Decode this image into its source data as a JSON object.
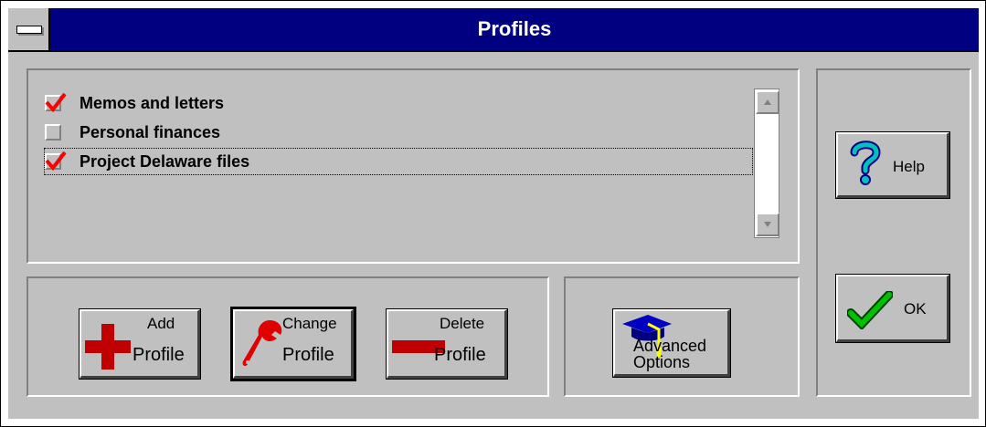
{
  "window": {
    "title": "Profiles"
  },
  "profiles": {
    "items": [
      {
        "label": "Memos and letters",
        "checked": true
      },
      {
        "label": "Personal finances",
        "checked": false
      },
      {
        "label": "Project Delaware files",
        "checked": true
      }
    ],
    "scroll_up_icon": "scroll-up-arrow-icon",
    "scroll_down_icon": "scroll-down-arrow-icon"
  },
  "actions": {
    "add": {
      "line1": "Add",
      "line2": "Profile",
      "icon": "plus-icon"
    },
    "change": {
      "line1": "Change",
      "line2": "Profile",
      "icon": "wrench-icon"
    },
    "delete": {
      "line1": "Delete",
      "line2": "Profile",
      "icon": "minus-icon"
    },
    "advanced": {
      "line1": "Advanced",
      "line2": "Options",
      "icon": "graduation-cap-icon"
    }
  },
  "side": {
    "help": {
      "label": "Help",
      "icon": "question-mark-icon"
    },
    "ok": {
      "label": "OK",
      "icon": "checkmark-icon"
    }
  },
  "colors": {
    "titlebar": "#000080",
    "check": "#ff0000",
    "face": "#c0c0c0"
  }
}
